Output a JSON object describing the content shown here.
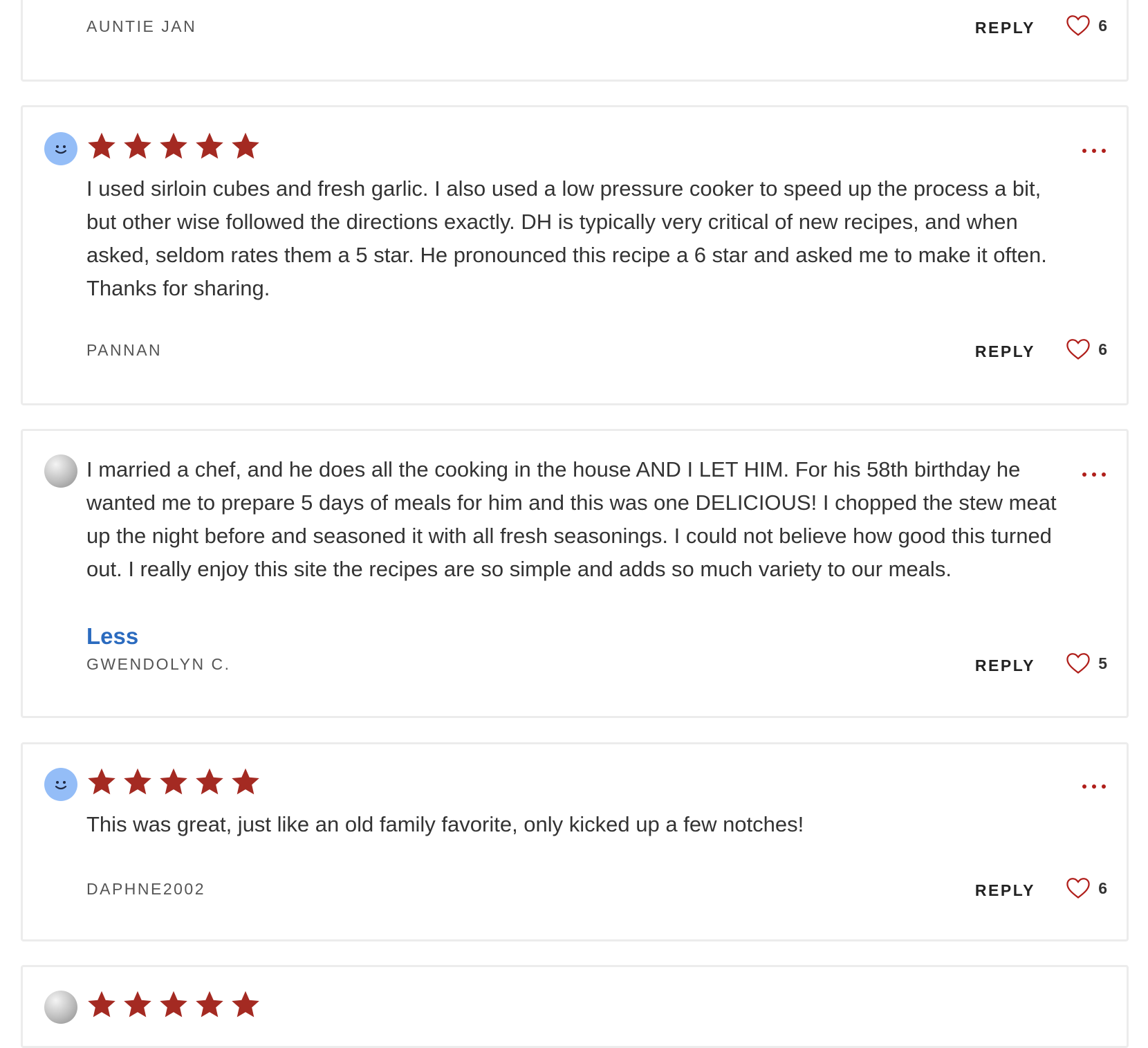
{
  "colors": {
    "star": "#a42a22",
    "heart": "#b01f1b",
    "less_link": "#2b6bbf",
    "avatar_blue": "#94bdf7"
  },
  "reviews": [
    {
      "author": "AUNTIE JAN",
      "reply_label": "REPLY",
      "likes": "6"
    },
    {
      "rating": 5,
      "avatar": "smiley-blue",
      "text": "I used sirloin cubes and fresh garlic. I also used a low pressure cooker to speed up the process a bit, but other wise followed the directions exactly. DH is typically very critical of new recipes, and when asked, seldom rates them a 5 star. He pronounced this recipe a 6 star and asked me to make it often. Thanks for sharing.",
      "author": "PANNAN",
      "reply_label": "REPLY",
      "likes": "6"
    },
    {
      "avatar": "photo-grey",
      "text": "I married a chef, and he does all the cooking in the house AND I LET HIM. For his 58th birthday he wanted me to prepare 5 days of meals for him and this was one DELICIOUS! I chopped the stew meat up the night before and seasoned it with all fresh seasonings. I could not believe how good this turned out. I really enjoy this site the recipes are so simple and adds so much variety to our meals.",
      "less_label": "Less",
      "author": "GWENDOLYN C.",
      "reply_label": "REPLY",
      "likes": "5"
    },
    {
      "rating": 5,
      "avatar": "smiley-blue",
      "text": "This was great, just like an old family favorite, only kicked up a few notches!",
      "author": "DAPHNE2002",
      "reply_label": "REPLY",
      "likes": "6"
    },
    {
      "rating": 5,
      "avatar": "photo-grey"
    }
  ]
}
